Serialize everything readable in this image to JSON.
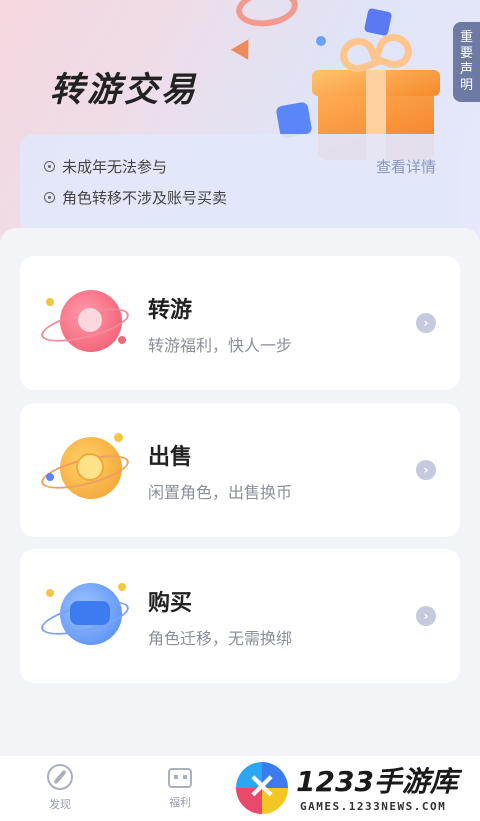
{
  "header": {
    "title": "转游交易",
    "notice_tab": [
      "重",
      "要",
      "声",
      "明"
    ]
  },
  "info": {
    "line1": "未成年无法参与",
    "line2": "角色转移不涉及账号买卖",
    "detail_link": "查看详情"
  },
  "cards": [
    {
      "title": "转游",
      "subtitle": "转游福利，快人一步",
      "icon": "star-planet-icon"
    },
    {
      "title": "出售",
      "subtitle": "闲置角色，出售换币",
      "icon": "coin-planet-icon"
    },
    {
      "title": "购买",
      "subtitle": "角色迁移，无需换绑",
      "icon": "gamepad-planet-icon"
    }
  ],
  "nav": {
    "items": [
      {
        "label": "发现",
        "icon": "compass-icon"
      },
      {
        "label": "福利",
        "icon": "robot-icon"
      }
    ]
  },
  "watermark": {
    "brand": "1233手游库",
    "url": "GAMES.1233NEWS.COM"
  },
  "colors": {
    "accent": "#6e7aa3",
    "card_bg": "#ffffff",
    "page_bg": "#f3f4f8"
  }
}
